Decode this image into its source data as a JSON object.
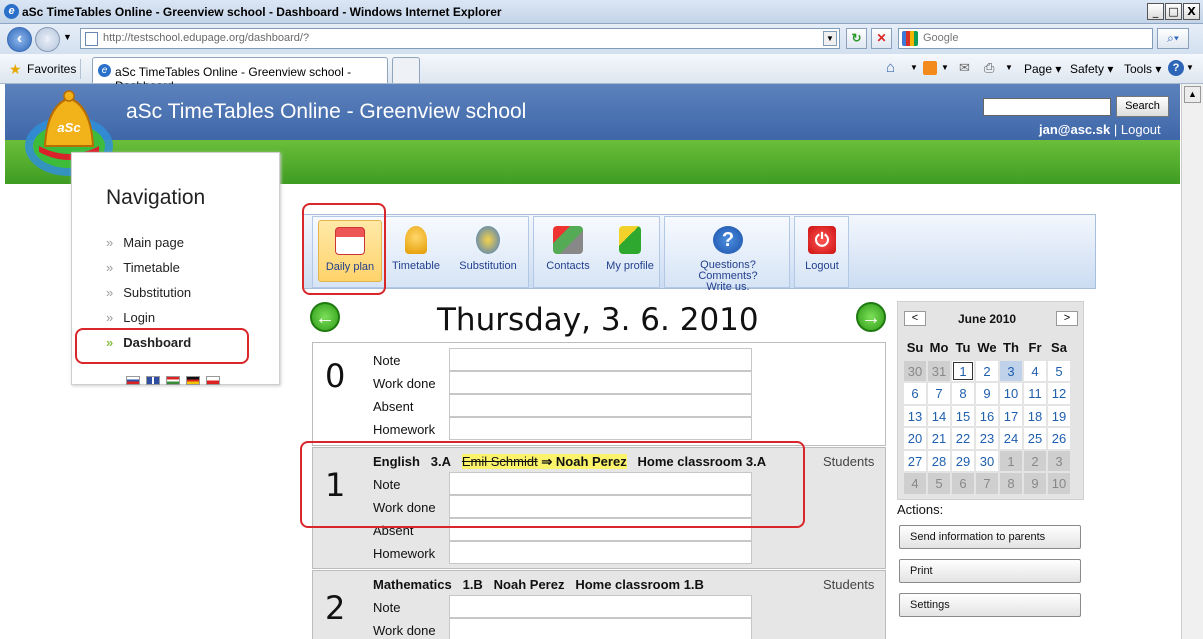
{
  "window": {
    "title": "aSc TimeTables Online - Greenview school - Dashboard - Windows Internet Explorer",
    "controls": [
      "_",
      "□",
      "X"
    ]
  },
  "browser": {
    "url": "http://testschool.edupage.org/dashboard/?",
    "search_placeholder": "Google",
    "favorites_label": "Favorites",
    "tab_title": "aSc TimeTables Online - Greenview school - Dashboard",
    "menu": {
      "page": "Page",
      "safety": "Safety",
      "tools": "Tools"
    }
  },
  "site": {
    "title": "aSc TimeTables Online - Greenview school",
    "logo_text": "aSc",
    "search_button": "Search",
    "user": "jan@asc.sk",
    "separator": "|",
    "logout": "Logout"
  },
  "navigation": {
    "title": "Navigation",
    "items": [
      "Main page",
      "Timetable",
      "Substitution",
      "Login",
      "Dashboard"
    ],
    "active": "Dashboard"
  },
  "toolbar": {
    "buttons": [
      {
        "label": "Daily plan",
        "icon": "calendar-icon"
      },
      {
        "label": "Timetable",
        "icon": "bell-icon"
      },
      {
        "label": "Substitution",
        "icon": "substitution-icon"
      },
      {
        "label": "Contacts",
        "icon": "contacts-icon"
      },
      {
        "label": "My profile",
        "icon": "profile-icon"
      },
      {
        "label": "Questions? Comments? Write us.",
        "icon": "question-icon"
      },
      {
        "label": "Logout",
        "icon": "power-icon"
      }
    ]
  },
  "day": {
    "date": "Thursday, 3. 6. 2010"
  },
  "lessons": [
    {
      "number": "0",
      "fields": [
        "Note",
        "Work done",
        "Absent",
        "Homework"
      ]
    },
    {
      "number": "1",
      "subject": "English",
      "class": "3.A",
      "old_teacher": "Emil Schmidt",
      "arrow": "⇒",
      "new_teacher": "Noah Perez",
      "room": "Home classroom 3.A",
      "students": "Students",
      "fields": [
        "Note",
        "Work done",
        "Absent",
        "Homework"
      ]
    },
    {
      "number": "2",
      "subject": "Mathematics",
      "class": "1.B",
      "teacher": "Noah Perez",
      "room": "Home classroom 1.B",
      "students": "Students",
      "fields": [
        "Note",
        "Work done"
      ]
    }
  ],
  "calendar": {
    "month": "June 2010",
    "prev": "<",
    "next": ">",
    "weekdays": [
      "Su",
      "Mo",
      "Tu",
      "We",
      "Th",
      "Fr",
      "Sa"
    ],
    "weeks": [
      [
        "30",
        "31",
        "1",
        "2",
        "3",
        "4",
        "5"
      ],
      [
        "6",
        "7",
        "8",
        "9",
        "10",
        "11",
        "12"
      ],
      [
        "13",
        "14",
        "15",
        "16",
        "17",
        "18",
        "19"
      ],
      [
        "20",
        "21",
        "22",
        "23",
        "24",
        "25",
        "26"
      ],
      [
        "27",
        "28",
        "29",
        "30",
        "1",
        "2",
        "3"
      ],
      [
        "4",
        "5",
        "6",
        "7",
        "8",
        "9",
        "10"
      ]
    ],
    "today": "1",
    "selected": "3"
  },
  "actions": {
    "label": "Actions:",
    "buttons": [
      "Send information to parents",
      "Print",
      "Settings"
    ]
  }
}
